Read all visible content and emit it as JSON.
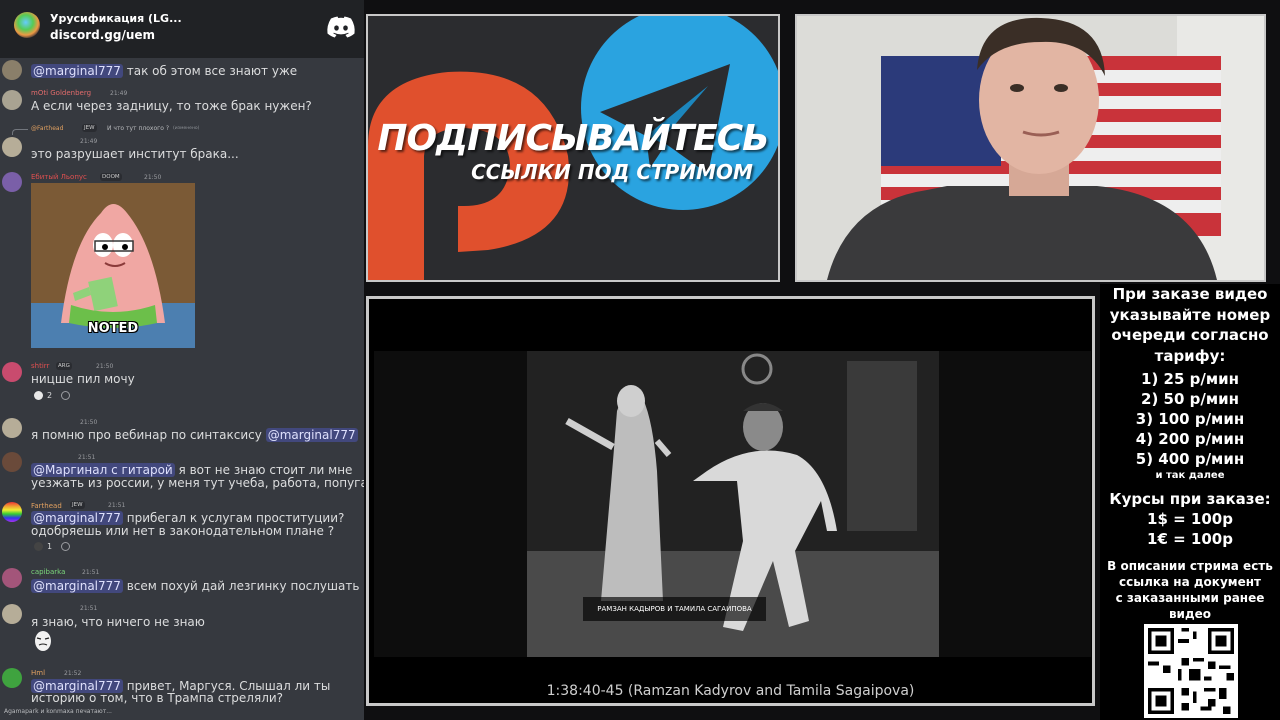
{
  "discord": {
    "server_name": "Урусификация (LG...",
    "invite": "discord.gg/uem",
    "typing": "Agamapark и konmaxa печатают..."
  },
  "messages": [
    {
      "mention": "@marginal777",
      "text": " так об этом все знают уже"
    },
    {
      "username": "mOti Goldenberg",
      "time": "21:49",
      "text": "А если через задницу, то тоже брак нужен?"
    },
    {
      "reply_user": "@Farthead",
      "reply_badge": "JEW",
      "reply_text": "И что тут плохого ?",
      "reply_edited": "(изменено)",
      "time": "21:49",
      "text": "это разрушает институт брака..."
    },
    {
      "username": "Ебитый Льопус",
      "badge": "DOOM",
      "time": "21:50",
      "meme_caption": "NOTED"
    },
    {
      "username": "shtirr",
      "badge": "ARG",
      "time": "21:50",
      "text": "ницше пил мочу",
      "reaction_count": "2"
    },
    {
      "time": "21:50",
      "text": "я помню про вебинар по синтаксису ",
      "mention": "@marginal777"
    },
    {
      "time": "21:51",
      "mention": "@Маргинал с гитарой",
      "text": " я вот не знаю стоит ли мне",
      "text2": "уезжать из россии, у меня тут учеба, работа, попугай"
    },
    {
      "username": "Farthead",
      "badge": "JEW",
      "time": "21:51",
      "mention": "@marginal777",
      "text": " прибегал к услугам  проституции?",
      "text2": "одобряешь или нет в законодательном плане ?",
      "reaction_count": "1"
    },
    {
      "username": "capibarka",
      "time": "21:51",
      "mention": "@marginal777",
      "text": " всем похуй дай лезгинку послушать"
    },
    {
      "time": "21:51",
      "text": "я знаю, что ничего не знаю"
    },
    {
      "username": "Hml",
      "time": "21:52",
      "mention": "@marginal777",
      "text": " привет, Маргуся. Слышал ли ты",
      "text2": "историю о том, что в Трампа стреляли?"
    }
  ],
  "banner": {
    "title": "ПОДПИСЫВАЙТЕСЬ",
    "subtitle": "ССЫЛКИ ПОД СТРИМОМ"
  },
  "video": {
    "lower_third": "РАМЗАН КАДЫРОВ И ТАМИЛА САГАИПОВА",
    "caption": "1:38:40-45 (Ramzan Kadyrov and Tamila Sagaipova)"
  },
  "info": {
    "heading": [
      "При заказе видео",
      "указывайте номер",
      "очереди согласно",
      "тарифу:"
    ],
    "tariffs": [
      "1) 25 р/мин",
      "2) 50 р/мин",
      "3) 100 р/мин",
      "4) 200 р/мин",
      "5) 400 р/мин"
    ],
    "etc": "и так далее",
    "rates_heading": "Курсы при заказе:",
    "rates": [
      "1$ = 100р",
      "1€ = 100р"
    ],
    "description": [
      "В описании стрима есть",
      "ссылка на документ",
      "с заказанными ранее",
      "видео"
    ]
  },
  "colors": {
    "discord_bg": "#36393f",
    "mention_bg": "#5865f2",
    "patreon": "#e0502d",
    "telegram": "#2aa3e0"
  }
}
